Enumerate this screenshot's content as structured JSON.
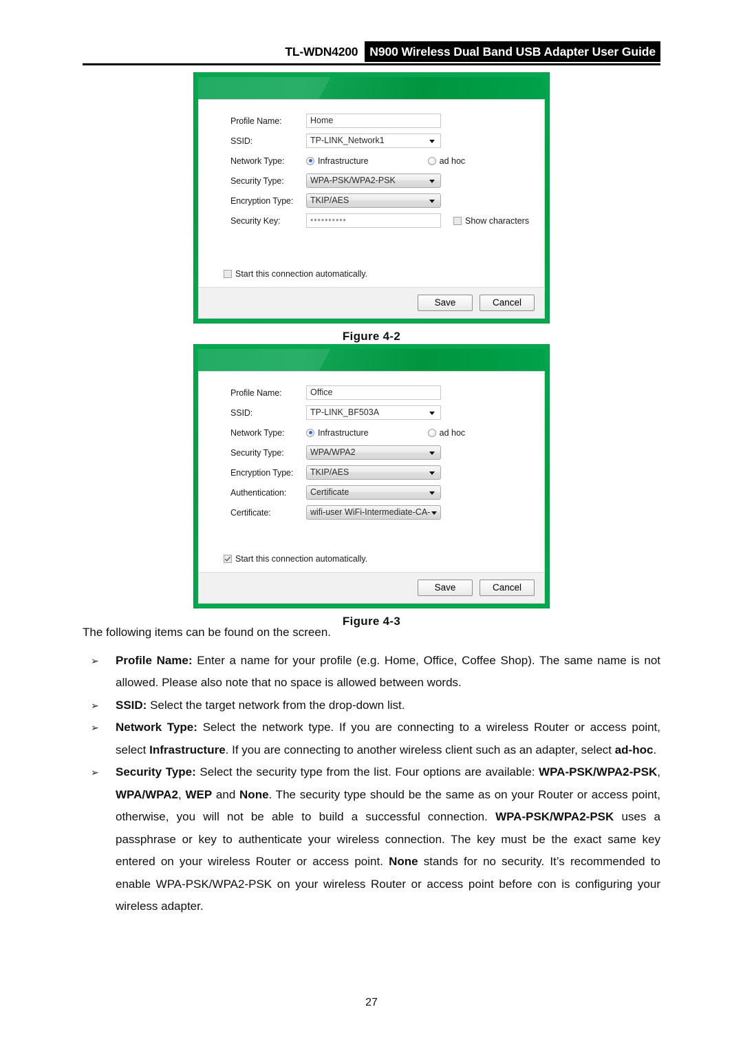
{
  "header": {
    "model": "TL-WDN4200",
    "banner_title": "N900 Wireless Dual Band USB Adapter User Guide"
  },
  "figures": [
    {
      "caption": "Figure 4-2",
      "fields": {
        "profile_name_label": "Profile Name:",
        "profile_name_value": "Home",
        "ssid_label": "SSID:",
        "ssid_value": "TP-LINK_Network1",
        "network_type_label": "Network Type:",
        "network_type_option_1": "Infrastructure",
        "network_type_option_2": "ad hoc",
        "network_type_selected": "Infrastructure",
        "security_type_label": "Security Type:",
        "security_type_value": "WPA-PSK/WPA2-PSK",
        "encryption_type_label": "Encryption Type:",
        "encryption_type_value": "TKIP/AES",
        "security_key_label": "Security Key:",
        "security_key_value": "**********",
        "show_characters_label": "Show characters",
        "show_characters_checked": false,
        "auto_start_label": "Start this connection automatically.",
        "auto_start_checked": false
      },
      "buttons": {
        "save": "Save",
        "cancel": "Cancel"
      }
    },
    {
      "caption": "Figure 4-3",
      "fields": {
        "profile_name_label": "Profile Name:",
        "profile_name_value": "Office",
        "ssid_label": "SSID:",
        "ssid_value": "TP-LINK_BF503A",
        "network_type_label": "Network Type:",
        "network_type_option_1": "Infrastructure",
        "network_type_option_2": "ad hoc",
        "network_type_selected": "Infrastructure",
        "security_type_label": "Security Type:",
        "security_type_value": "WPA/WPA2",
        "encryption_type_label": "Encryption Type:",
        "encryption_type_value": "TKIP/AES",
        "authentication_label": "Authentication:",
        "authentication_value": "Certificate",
        "certificate_label": "Certificate:",
        "certificate_value": "wifi-user WiFi-Intermediate-CA-",
        "auto_start_label": "Start this connection automatically.",
        "auto_start_checked": true
      },
      "buttons": {
        "save": "Save",
        "cancel": "Cancel"
      }
    }
  ],
  "body": {
    "intro": "The following items can be found on the screen.",
    "bullet_marker": "➢",
    "items": [
      {
        "term": "Profile Name:",
        "text": " Enter a name for your profile (e.g. Home, Office, Coffee Shop). The same name is not allowed. Please also note that no space is allowed between words."
      },
      {
        "term": "SSID:",
        "text": " Select the target network from the drop-down list."
      },
      {
        "term": "Network Type:",
        "text_part_1": " Select the network type. If you are connecting to a wireless Router or access point, select ",
        "bold_1": "Infrastructure",
        "text_part_2": ". If you are connecting to another wireless client such as an adapter, select ",
        "bold_2": "ad-hoc",
        "text_part_3": "."
      },
      {
        "term": "Security Type:",
        "text_part_1": " Select the security type from the list. Four options are available: ",
        "bold_1": "WPA-PSK/WPA2-PSK",
        "text_part_2": ", ",
        "bold_2": "WPA/WPA2",
        "text_part_3": ", ",
        "bold_3": "WEP",
        "text_part_4": " and ",
        "bold_4": "None",
        "text_part_5": ". The security type should be the same as on your Router or access point, otherwise, you will not be able to build a successful connection. ",
        "bold_5": "WPA-PSK/WPA2-PSK",
        "text_part_6": " uses a passphrase or key to authenticate your wireless connection. The key must be the exact same key entered on your wireless Router or access point. ",
        "bold_6": "None",
        "text_part_7": " stands for no security. It’s recommended to enable WPA-PSK/WPA2-PSK on your wireless Router or access point before con is configuring your wireless adapter."
      }
    ]
  },
  "footer": {
    "page_number": "27"
  }
}
